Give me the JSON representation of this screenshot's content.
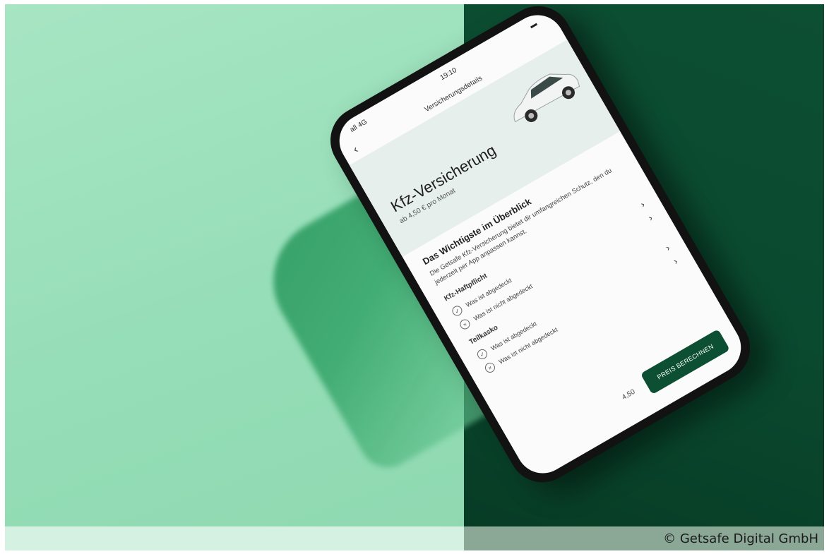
{
  "photo": {
    "colors": {
      "mint": "#96ddb7",
      "forest": "#0a4a2f",
      "button": "#0d4f33"
    }
  },
  "app_screen": {
    "status_time": "19:10",
    "status_carrier": "all 4G",
    "nav_title": "Versicherungsdetails",
    "back_icon": "chevron-left-icon",
    "product_title": "Kfz-Versicherung",
    "product_price": "ab 4,50 € pro Monat",
    "overview_title": "Das Wichtigste im Überblick",
    "overview_text": "Die Getsafe Kfz-Versicherung bietet dir umfangreichen Schutz, den du jederzeit per App anpassen kannst.",
    "groups": [
      {
        "title": "Kfz-Haftpflicht",
        "rows": [
          {
            "label": "Was ist abgedeckt",
            "icon": "check-circle-icon"
          },
          {
            "label": "Was ist nicht abgedeckt",
            "icon": "x-circle-icon"
          }
        ]
      },
      {
        "title": "Teilkasko",
        "rows": [
          {
            "label": "Was ist abgedeckt",
            "icon": "check-circle-icon"
          },
          {
            "label": "Was ist nicht abgedeckt",
            "icon": "x-circle-icon"
          }
        ]
      }
    ],
    "price_label": "4,50",
    "cta_label": "PREIS BERECHNEN"
  },
  "caption": "© Getsafe Digital GmbH"
}
